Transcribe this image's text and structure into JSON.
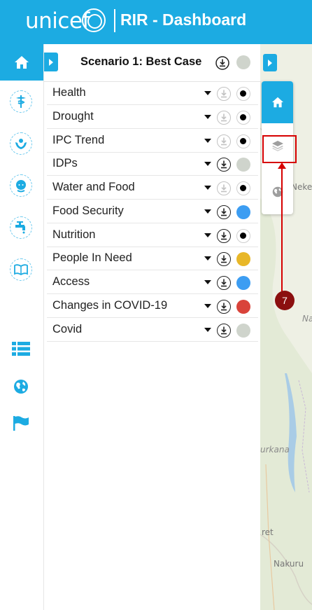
{
  "header": {
    "logo_text": "unicef",
    "title": "RIR - Dashboard",
    "brand_color": "#1cabe2"
  },
  "rail": {
    "items": [
      {
        "icon": "home-icon",
        "active": true
      },
      {
        "icon": "health-caduceus-icon"
      },
      {
        "icon": "protection-hands-icon"
      },
      {
        "icon": "child-face-icon"
      },
      {
        "icon": "water-tap-icon"
      },
      {
        "icon": "education-book-icon"
      },
      {
        "icon": "list-icon"
      },
      {
        "icon": "globe-icon"
      },
      {
        "icon": "flag-icon"
      }
    ]
  },
  "panel": {
    "scenario_title": "Scenario 1: Best Case",
    "scenario_dot_color": "#cfd4cc",
    "layers": [
      {
        "label": "Health",
        "download_enabled": false,
        "dot": "black"
      },
      {
        "label": "Drought",
        "download_enabled": false,
        "dot": "black"
      },
      {
        "label": "IPC Trend",
        "download_enabled": false,
        "dot": "black"
      },
      {
        "label": "IDPs",
        "download_enabled": true,
        "dot": "#cfd4cc"
      },
      {
        "label": "Water and Food",
        "download_enabled": false,
        "dot": "black"
      },
      {
        "label": "Food Security",
        "download_enabled": true,
        "dot": "#3c9df2"
      },
      {
        "label": "Nutrition",
        "download_enabled": true,
        "dot": "black"
      },
      {
        "label": "People In Need",
        "download_enabled": true,
        "dot": "#e8b728"
      },
      {
        "label": "Access",
        "download_enabled": true,
        "dot": "#3c9df2"
      },
      {
        "label": "Changes in COVID-19",
        "download_enabled": true,
        "dot": "#d9433a"
      },
      {
        "label": "Covid",
        "download_enabled": true,
        "dot": "#cfd4cc"
      }
    ]
  },
  "map": {
    "labels": [
      "Nekem",
      "Na",
      "urkana",
      "ret",
      "Nakuru"
    ],
    "controls": [
      "map-home-icon",
      "layers-icon",
      "globe-icon"
    ]
  },
  "annotation": {
    "badge": "7",
    "color": "#d60000"
  }
}
